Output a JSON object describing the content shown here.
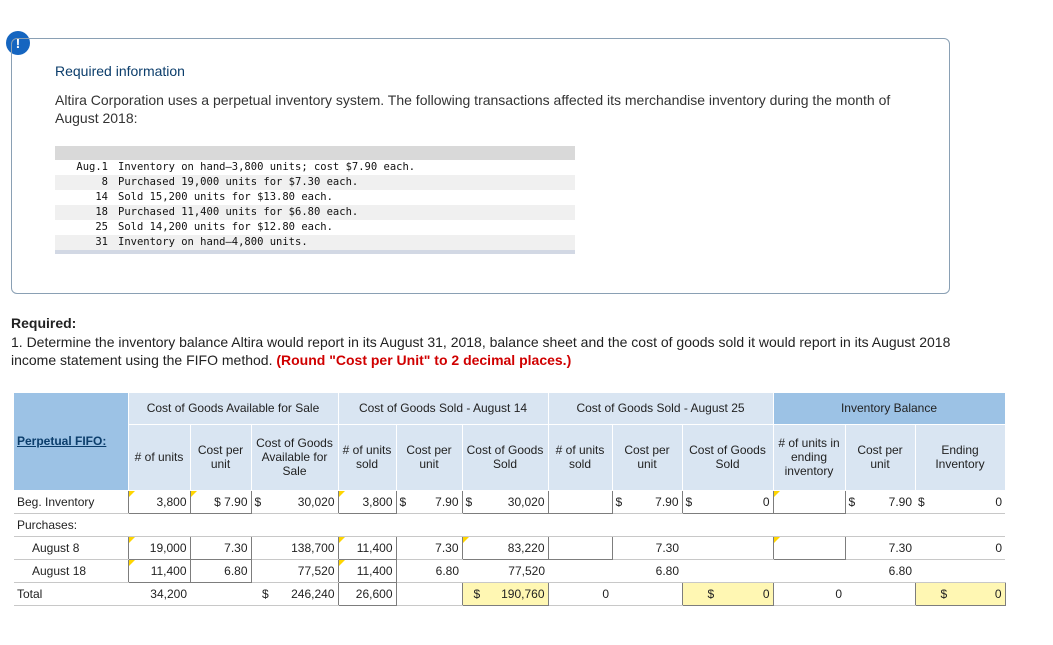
{
  "alert": {
    "icon": "!"
  },
  "info": {
    "title": "Required information",
    "text": "Altira Corporation uses a perpetual inventory system. The following transactions affected its merchandise inventory during the month of August 2018:",
    "transactions": [
      {
        "date": "Aug.1",
        "text": "Inventory on hand—3,800 units; cost $7.90 each."
      },
      {
        "date": "8",
        "text": "Purchased 19,000 units for $7.30 each."
      },
      {
        "date": "14",
        "text": "Sold 15,200 units for $13.80 each."
      },
      {
        "date": "18",
        "text": "Purchased 11,400 units for $6.80 each."
      },
      {
        "date": "25",
        "text": "Sold 14,200 units for $12.80 each."
      },
      {
        "date": "31",
        "text": "Inventory on hand—4,800 units."
      }
    ]
  },
  "required": {
    "label": "Required:",
    "text": "1. Determine the inventory balance Altira would report in its August 31, 2018, balance sheet and the cost of goods sold it would report in its August 2018 income statement using the FIFO method.",
    "note": "(Round \"Cost per Unit\" to 2 decimal places.)"
  },
  "table": {
    "fifo_label": "Perpetual FIFO:",
    "groups": {
      "cogas": "Cost of Goods Available for Sale",
      "aug14": "Cost of Goods Sold - August 14",
      "aug25": "Cost of Goods Sold - August 25",
      "balance": "Inventory Balance"
    },
    "cols": {
      "units": "# of units",
      "cpu": "Cost per unit",
      "cogas": "Cost of Goods Available for Sale",
      "units_sold": "# of units sold",
      "cogs": "Cost of Goods Sold",
      "units_sold2": "# of units sold",
      "units_end": "# of units in ending inventory",
      "ending": "Ending Inventory"
    },
    "rows": {
      "beg": {
        "label": "Beg. Inventory",
        "units": "3,800",
        "cpu": "$ 7.90",
        "cogas": "30,020",
        "s14_units": "3,800",
        "s14_cpu": "7.90",
        "s14_cogs": "30,020",
        "s25_units": "",
        "s25_cpu": "7.90",
        "s25_cogs": "0",
        "end_units": "",
        "end_cpu": "7.90",
        "end_inv": "0"
      },
      "purchases": {
        "label": "Purchases:"
      },
      "aug8": {
        "label": "August 8",
        "units": "19,000",
        "cpu": "7.30",
        "cogas": "138,700",
        "s14_units": "11,400",
        "s14_cpu": "7.30",
        "s14_cogs": "83,220",
        "s25_units": "",
        "s25_cpu": "7.30",
        "s25_cogs": "",
        "end_units": "",
        "end_cpu": "7.30",
        "end_inv": "0"
      },
      "aug18": {
        "label": "August 18",
        "units": "11,400",
        "cpu": "6.80",
        "cogas": "77,520",
        "s14_units": "11,400",
        "s14_cpu": "6.80",
        "s14_cogs": "77,520",
        "s25_units": "",
        "s25_cpu": "6.80",
        "s25_cogs": "",
        "end_units": "",
        "end_cpu": "6.80",
        "end_inv": ""
      },
      "total": {
        "label": "Total",
        "units": "34,200",
        "cogas": "246,240",
        "s14_units": "26,600",
        "s14_cogs": "190,760",
        "s25_units": "0",
        "s25_cogs": "0",
        "end_units": "0",
        "end_inv": "0"
      }
    },
    "currency": "$"
  }
}
